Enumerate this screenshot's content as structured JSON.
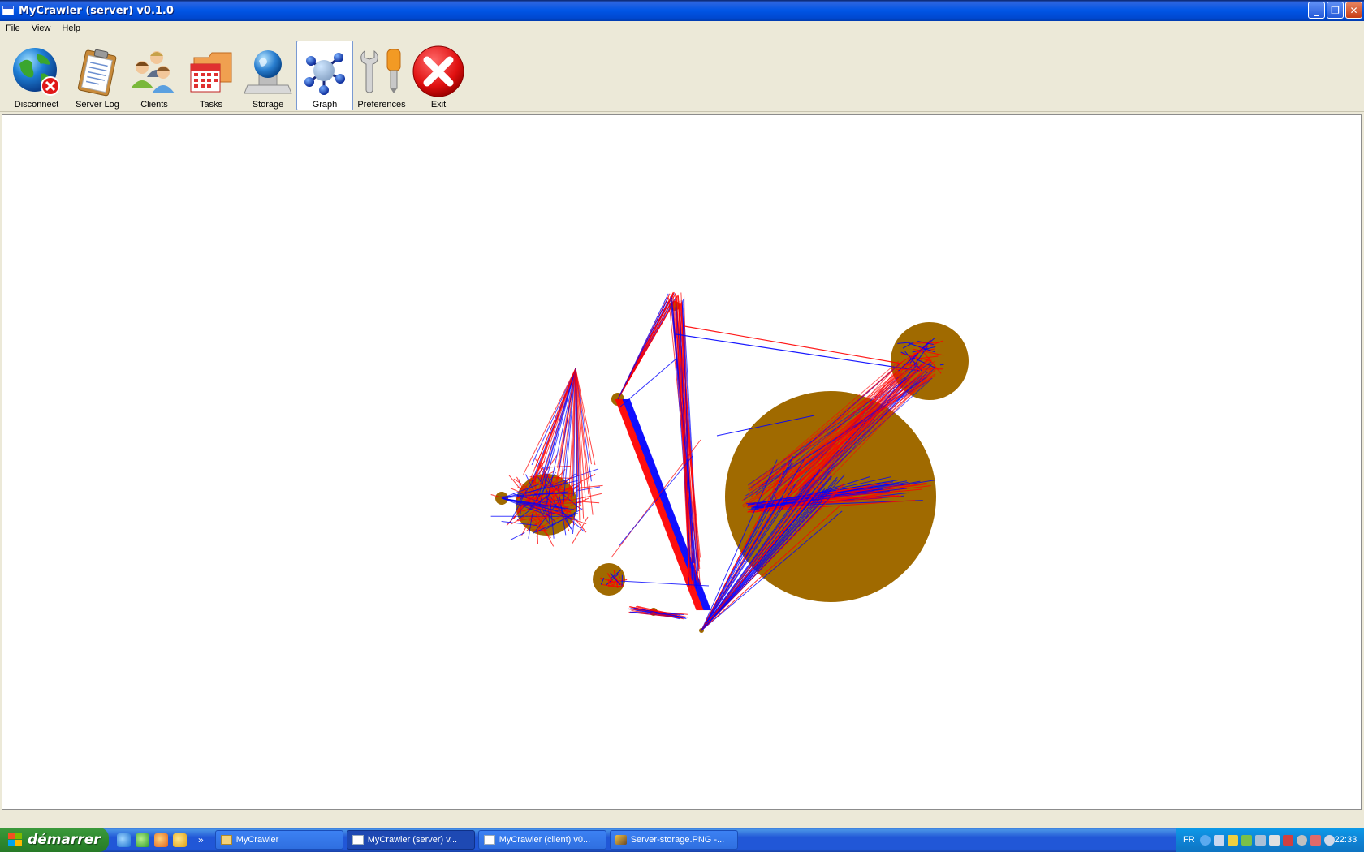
{
  "window": {
    "title": "MyCrawler (server) v0.1.0",
    "buttons": [
      "minimize",
      "restore",
      "close"
    ]
  },
  "menu": [
    {
      "label": "File"
    },
    {
      "label": "View"
    },
    {
      "label": "Help"
    }
  ],
  "toolbar": {
    "items": [
      {
        "label": "Disconnect",
        "icon": "globe-disconnect-icon"
      },
      {
        "label": "Server Log",
        "icon": "clipboard-icon"
      },
      {
        "label": "Clients",
        "icon": "users-icon"
      },
      {
        "label": "Tasks",
        "icon": "calendar-folder-icon"
      },
      {
        "label": "Storage",
        "icon": "globe-drive-icon"
      },
      {
        "label": "Graph",
        "icon": "molecule-icon",
        "active": true
      },
      {
        "label": "Preferences",
        "icon": "tools-icon"
      },
      {
        "label": "Exit",
        "icon": "exit-icon"
      }
    ]
  },
  "graph": {
    "node_color": "#A06A00",
    "edge_colors": [
      "#FF0000",
      "#0000FF"
    ]
  },
  "taskbar": {
    "start_label": "démarrer",
    "quick_launch": [
      "ie-icon",
      "messenger-icon",
      "firefox-icon",
      "media-player-icon"
    ],
    "overflow": "»",
    "tasks": [
      {
        "label": "MyCrawler",
        "icon": "folder-icon",
        "state": "normal"
      },
      {
        "label": "MyCrawler (server) v...",
        "icon": "window-icon",
        "state": "pressed"
      },
      {
        "label": "MyCrawler (client) v0...",
        "icon": "window-icon",
        "state": "normal"
      },
      {
        "label": "Server-storage.PNG -...",
        "icon": "paint-icon",
        "state": "normal"
      }
    ],
    "tray": {
      "language": "FR",
      "clock": "22:33"
    }
  }
}
